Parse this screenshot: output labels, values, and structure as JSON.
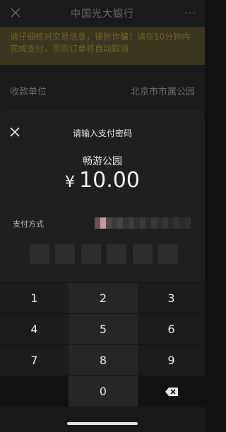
{
  "nav": {
    "title": "中国光大银行",
    "more": "···"
  },
  "notice": {
    "text": "请仔细核对交易信息，谨防诈骗！请在10分钟内完成支付，否则订单将自动取消"
  },
  "payee": {
    "label": "收款单位",
    "value": "北京市市属公园"
  },
  "sheet": {
    "title": "请输入支付密码",
    "merchant": "畅游公园",
    "currency_symbol": "¥",
    "amount": "10.00",
    "payment_method_label": "支付方式",
    "pin_length": 6
  },
  "keypad": {
    "keys": [
      "1",
      "2",
      "3",
      "4",
      "5",
      "6",
      "7",
      "8",
      "9",
      "",
      "0",
      "⌫"
    ]
  },
  "colors": {
    "accent": "#f0f0f0",
    "sheet_bg": "#1f1f1f",
    "notice_bg": "#3a3520"
  },
  "icons": {
    "close": "close-icon",
    "backspace": "backspace-icon"
  }
}
